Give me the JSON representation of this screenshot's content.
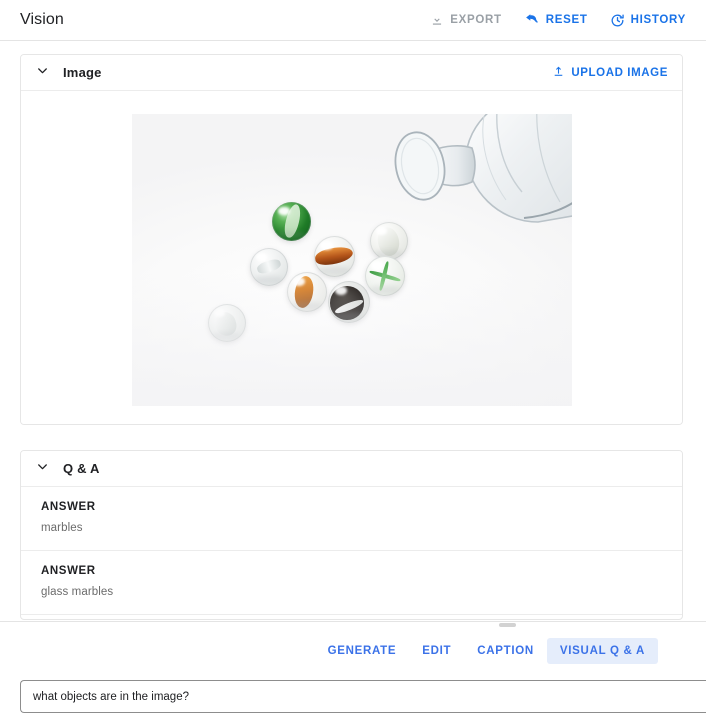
{
  "app": {
    "title": "Vision",
    "actions": [
      {
        "id": "export",
        "label": "EXPORT",
        "icon": "download-icon",
        "enabled": false,
        "color": "#9aa0a6"
      },
      {
        "id": "reset",
        "label": "RESET",
        "icon": "undo-arrow-icon",
        "enabled": true,
        "color": "#1a73e8"
      },
      {
        "id": "history",
        "label": "HISTORY",
        "icon": "clock-restore-icon",
        "enabled": true,
        "color": "#1a73e8"
      }
    ]
  },
  "image_card": {
    "title": "Image",
    "collapse_icon": "chevron-down-icon",
    "upload_label": "UPLOAD IMAGE",
    "upload_icon": "upload-icon",
    "photo": {
      "description": "Clear glass marbles spilling out of a tipped-over clear glass goblet on a white background",
      "background": "#fafafa",
      "objects": [
        {
          "name": "glass-goblet",
          "color": "#eef1f3"
        },
        {
          "name": "marble-green-swirl",
          "color": "#2f8a34"
        },
        {
          "name": "marble-clear-white",
          "color": "#e9ebeb"
        },
        {
          "name": "marble-orange-swirl-top",
          "color": "#c8641a"
        },
        {
          "name": "marble-orange-swirl-low",
          "color": "#d9791f"
        },
        {
          "name": "marble-black-swirl",
          "color": "#17120f"
        },
        {
          "name": "marble-white-cream",
          "color": "#ededea"
        },
        {
          "name": "marble-green-cross",
          "color": "#3f9e45"
        },
        {
          "name": "marble-grey-clear",
          "color": "#e4e6e6"
        }
      ]
    }
  },
  "qa_card": {
    "title": "Q & A",
    "collapse_icon": "chevron-down-icon",
    "rows": [
      {
        "label": "ANSWER",
        "text": "marbles"
      },
      {
        "label": "ANSWER",
        "text": "glass marbles"
      }
    ]
  },
  "bottom": {
    "tabs": [
      {
        "id": "generate",
        "label": "GENERATE",
        "active": false
      },
      {
        "id": "edit",
        "label": "EDIT",
        "active": false
      },
      {
        "id": "caption",
        "label": "CAPTION",
        "active": false
      },
      {
        "id": "visual-q-a",
        "label": "VISUAL Q & A",
        "active": true
      }
    ],
    "prompt": {
      "value": "what objects are in the image?",
      "placeholder": "what objects are in the image?"
    }
  },
  "colors": {
    "accent": "#1a73e8",
    "tab_accent": "#3b72e8",
    "tab_active_bg": "#e5edfb",
    "disabled": "#9aa0a6",
    "border": "#e6e6e6",
    "text": "#202124",
    "muted": "#6b6b6b"
  }
}
